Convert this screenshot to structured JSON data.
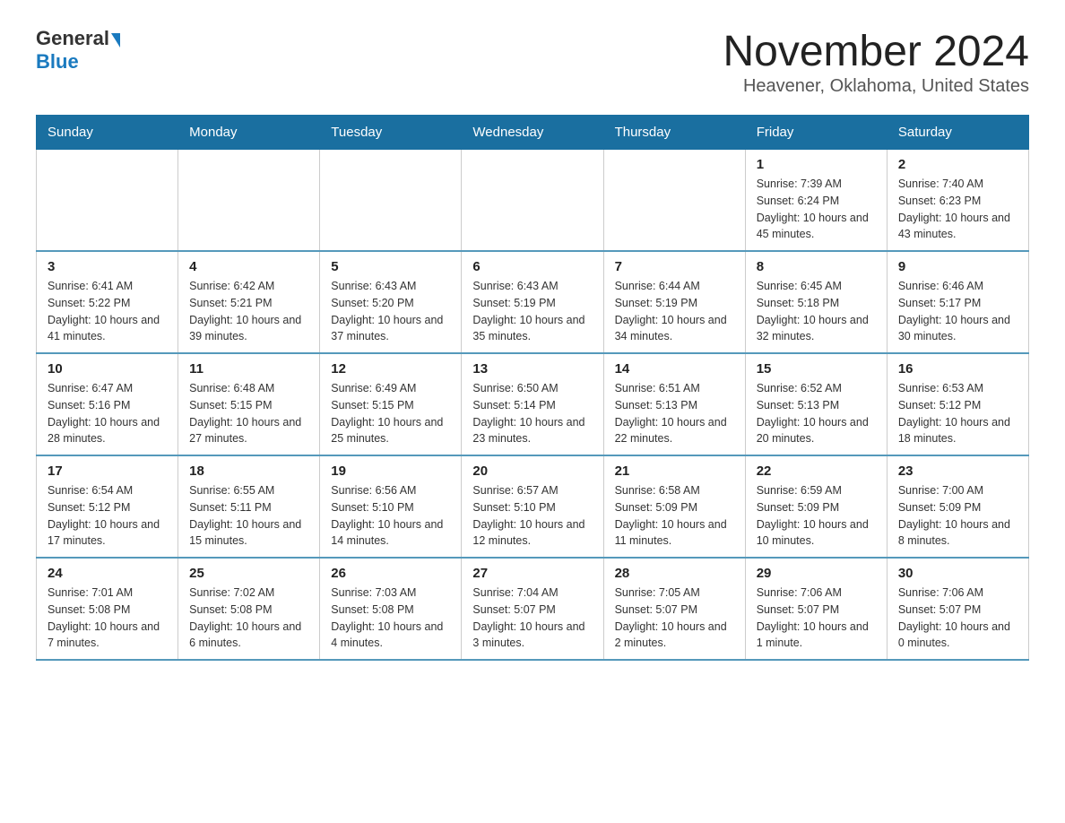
{
  "logo": {
    "general": "General",
    "blue": "Blue"
  },
  "title": "November 2024",
  "subtitle": "Heavener, Oklahoma, United States",
  "days_of_week": [
    "Sunday",
    "Monday",
    "Tuesday",
    "Wednesday",
    "Thursday",
    "Friday",
    "Saturday"
  ],
  "weeks": [
    [
      {
        "day": "",
        "info": ""
      },
      {
        "day": "",
        "info": ""
      },
      {
        "day": "",
        "info": ""
      },
      {
        "day": "",
        "info": ""
      },
      {
        "day": "",
        "info": ""
      },
      {
        "day": "1",
        "info": "Sunrise: 7:39 AM\nSunset: 6:24 PM\nDaylight: 10 hours and 45 minutes."
      },
      {
        "day": "2",
        "info": "Sunrise: 7:40 AM\nSunset: 6:23 PM\nDaylight: 10 hours and 43 minutes."
      }
    ],
    [
      {
        "day": "3",
        "info": "Sunrise: 6:41 AM\nSunset: 5:22 PM\nDaylight: 10 hours and 41 minutes."
      },
      {
        "day": "4",
        "info": "Sunrise: 6:42 AM\nSunset: 5:21 PM\nDaylight: 10 hours and 39 minutes."
      },
      {
        "day": "5",
        "info": "Sunrise: 6:43 AM\nSunset: 5:20 PM\nDaylight: 10 hours and 37 minutes."
      },
      {
        "day": "6",
        "info": "Sunrise: 6:43 AM\nSunset: 5:19 PM\nDaylight: 10 hours and 35 minutes."
      },
      {
        "day": "7",
        "info": "Sunrise: 6:44 AM\nSunset: 5:19 PM\nDaylight: 10 hours and 34 minutes."
      },
      {
        "day": "8",
        "info": "Sunrise: 6:45 AM\nSunset: 5:18 PM\nDaylight: 10 hours and 32 minutes."
      },
      {
        "day": "9",
        "info": "Sunrise: 6:46 AM\nSunset: 5:17 PM\nDaylight: 10 hours and 30 minutes."
      }
    ],
    [
      {
        "day": "10",
        "info": "Sunrise: 6:47 AM\nSunset: 5:16 PM\nDaylight: 10 hours and 28 minutes."
      },
      {
        "day": "11",
        "info": "Sunrise: 6:48 AM\nSunset: 5:15 PM\nDaylight: 10 hours and 27 minutes."
      },
      {
        "day": "12",
        "info": "Sunrise: 6:49 AM\nSunset: 5:15 PM\nDaylight: 10 hours and 25 minutes."
      },
      {
        "day": "13",
        "info": "Sunrise: 6:50 AM\nSunset: 5:14 PM\nDaylight: 10 hours and 23 minutes."
      },
      {
        "day": "14",
        "info": "Sunrise: 6:51 AM\nSunset: 5:13 PM\nDaylight: 10 hours and 22 minutes."
      },
      {
        "day": "15",
        "info": "Sunrise: 6:52 AM\nSunset: 5:13 PM\nDaylight: 10 hours and 20 minutes."
      },
      {
        "day": "16",
        "info": "Sunrise: 6:53 AM\nSunset: 5:12 PM\nDaylight: 10 hours and 18 minutes."
      }
    ],
    [
      {
        "day": "17",
        "info": "Sunrise: 6:54 AM\nSunset: 5:12 PM\nDaylight: 10 hours and 17 minutes."
      },
      {
        "day": "18",
        "info": "Sunrise: 6:55 AM\nSunset: 5:11 PM\nDaylight: 10 hours and 15 minutes."
      },
      {
        "day": "19",
        "info": "Sunrise: 6:56 AM\nSunset: 5:10 PM\nDaylight: 10 hours and 14 minutes."
      },
      {
        "day": "20",
        "info": "Sunrise: 6:57 AM\nSunset: 5:10 PM\nDaylight: 10 hours and 12 minutes."
      },
      {
        "day": "21",
        "info": "Sunrise: 6:58 AM\nSunset: 5:09 PM\nDaylight: 10 hours and 11 minutes."
      },
      {
        "day": "22",
        "info": "Sunrise: 6:59 AM\nSunset: 5:09 PM\nDaylight: 10 hours and 10 minutes."
      },
      {
        "day": "23",
        "info": "Sunrise: 7:00 AM\nSunset: 5:09 PM\nDaylight: 10 hours and 8 minutes."
      }
    ],
    [
      {
        "day": "24",
        "info": "Sunrise: 7:01 AM\nSunset: 5:08 PM\nDaylight: 10 hours and 7 minutes."
      },
      {
        "day": "25",
        "info": "Sunrise: 7:02 AM\nSunset: 5:08 PM\nDaylight: 10 hours and 6 minutes."
      },
      {
        "day": "26",
        "info": "Sunrise: 7:03 AM\nSunset: 5:08 PM\nDaylight: 10 hours and 4 minutes."
      },
      {
        "day": "27",
        "info": "Sunrise: 7:04 AM\nSunset: 5:07 PM\nDaylight: 10 hours and 3 minutes."
      },
      {
        "day": "28",
        "info": "Sunrise: 7:05 AM\nSunset: 5:07 PM\nDaylight: 10 hours and 2 minutes."
      },
      {
        "day": "29",
        "info": "Sunrise: 7:06 AM\nSunset: 5:07 PM\nDaylight: 10 hours and 1 minute."
      },
      {
        "day": "30",
        "info": "Sunrise: 7:06 AM\nSunset: 5:07 PM\nDaylight: 10 hours and 0 minutes."
      }
    ]
  ]
}
